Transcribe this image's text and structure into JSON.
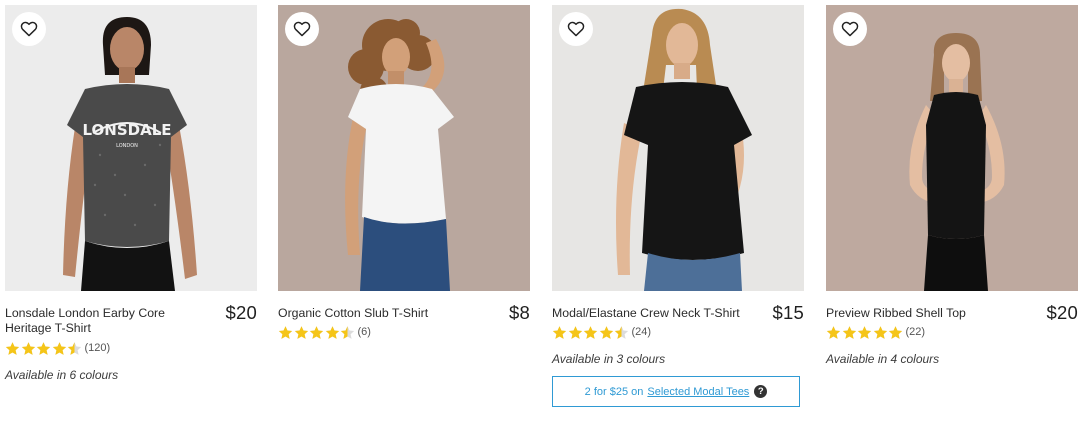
{
  "products": [
    {
      "name": "Lonsdale London Earby Core Heritage T-Shirt",
      "price": "$20",
      "rating_stars": 4.5,
      "review_count": "(120)",
      "availability": "Available in 6 colours",
      "image_bg": "#ececec",
      "tee_color": "#4a4a4a",
      "print_text": "LONSDALE",
      "print_sub": "LONDON"
    },
    {
      "name": "Organic Cotton Slub T-Shirt",
      "price": "$8",
      "rating_stars": 4.5,
      "review_count": "(6)",
      "availability": "",
      "image_bg": "#b9a79e",
      "tee_color": "#f4f4f4"
    },
    {
      "name": "Modal/Elastane Crew Neck T-Shirt",
      "price": "$15",
      "rating_stars": 4.5,
      "review_count": "(24)",
      "availability": "Available in 3 colours",
      "image_bg": "#e7e6e4",
      "tee_color": "#151515",
      "promo": {
        "prefix": "2 for $25 on",
        "link": "Selected Modal Tees",
        "help_glyph": "?"
      }
    },
    {
      "name": "Preview Ribbed Shell Top",
      "price": "$20",
      "rating_stars": 5,
      "review_count": "(22)",
      "availability": "Available in 4 colours",
      "image_bg": "#bea99f",
      "tee_color": "#141414"
    }
  ],
  "colors": {
    "star_fill": "#f5c518",
    "promo_accent": "#2f9ad4",
    "text": "#2b2b2b"
  },
  "icons": {
    "favourite": "heart-outline-icon",
    "rating": "star-icon",
    "help": "question-circle-icon"
  }
}
